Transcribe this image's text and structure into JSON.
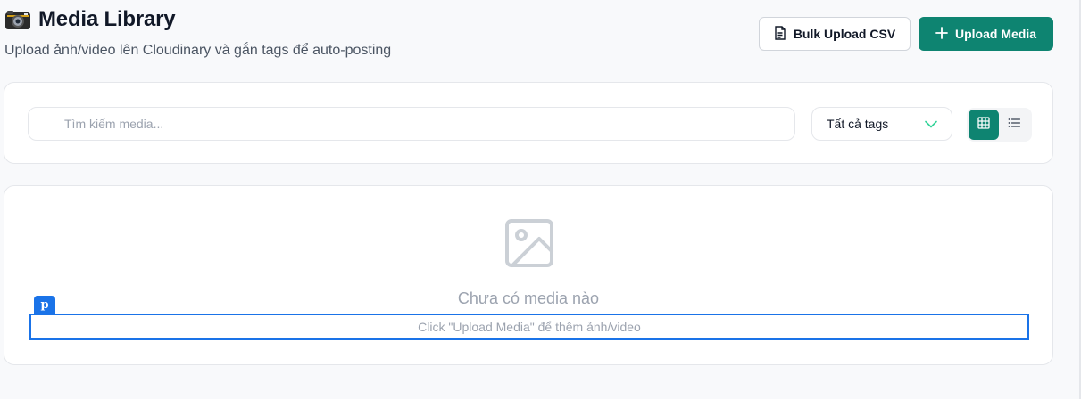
{
  "header": {
    "title": "Media Library",
    "subtitle": "Upload ảnh/video lên Cloudinary và gắn tags để auto-posting",
    "title_icon": "camera-icon"
  },
  "actions": {
    "bulk_upload_label": "Bulk Upload CSV",
    "bulk_upload_icon": "file-icon",
    "upload_label": "Upload Media",
    "upload_icon": "plus-icon"
  },
  "filters": {
    "search_placeholder": "Tìm kiếm media...",
    "search_value": "",
    "tags_selected": "Tất cả tags",
    "view_mode": "grid"
  },
  "empty_state": {
    "icon": "image-icon",
    "title": "Chưa có media nào",
    "hint": "Click \"Upload Media\" để thêm ảnh/video",
    "inspector_badge": "p"
  },
  "colors": {
    "accent": "#0e8471",
    "inspector_highlight": "#1a73e8",
    "muted_text": "#9ca3af"
  }
}
